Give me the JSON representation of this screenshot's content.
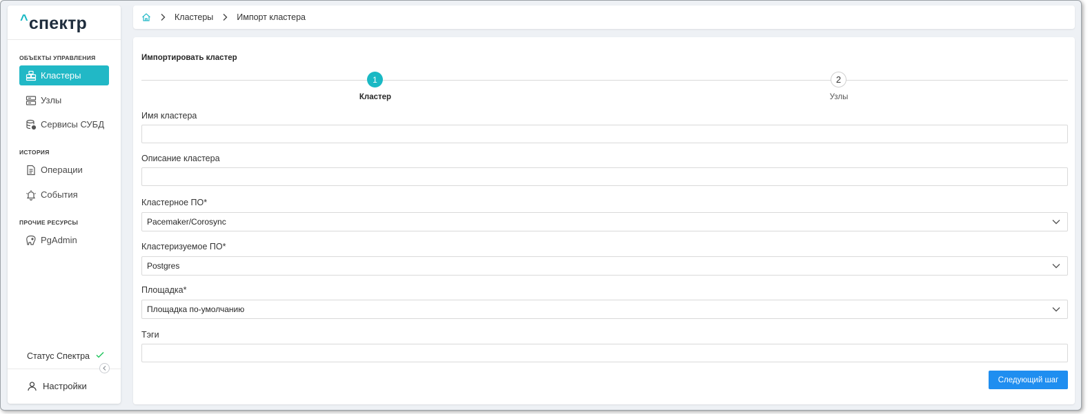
{
  "app": {
    "logo_caret": "^",
    "logo_text": "спектр"
  },
  "sidebar": {
    "sections": [
      {
        "title": "ОБЪЕКТЫ УПРАВЛЕНИЯ"
      },
      {
        "title": "ИСТОРИЯ"
      },
      {
        "title": "ПРОЧИЕ РЕСУРСЫ"
      }
    ],
    "items": [
      {
        "label": "Кластеры",
        "icon": "clusters-icon",
        "active": true
      },
      {
        "label": "Узлы",
        "icon": "nodes-icon",
        "active": false
      },
      {
        "label": "Сервисы СУБД",
        "icon": "database-services-icon",
        "active": false
      },
      {
        "label": "Операции",
        "icon": "operations-icon",
        "active": false
      },
      {
        "label": "События",
        "icon": "events-icon",
        "active": false
      },
      {
        "label": "PgAdmin",
        "icon": "pgadmin-icon",
        "active": false
      }
    ],
    "status_label": "Статус Спектра",
    "settings_label": "Настройки"
  },
  "breadcrumb": {
    "items": [
      "Кластеры",
      "Импорт кластера"
    ]
  },
  "form": {
    "title": "Импортировать кластер",
    "steps": [
      {
        "number": "1",
        "label": "Кластер",
        "active": true
      },
      {
        "number": "2",
        "label": "Узлы",
        "active": false
      }
    ],
    "fields": {
      "cluster_name": {
        "label": "Имя кластера",
        "value": ""
      },
      "cluster_description": {
        "label": "Описание кластера",
        "value": ""
      },
      "cluster_software": {
        "label": "Кластерное ПО*",
        "value": "Pacemaker/Corosync"
      },
      "clustered_software": {
        "label": "Кластеризуемое ПО*",
        "value": "Postgres"
      },
      "site": {
        "label": "Площадка*",
        "value": "Площадка по-умолчанию"
      },
      "tags": {
        "label": "Тэги",
        "value": ""
      }
    },
    "next_button": "Следующий шаг"
  },
  "colors": {
    "accent": "#21b8c6",
    "primary_button": "#1f8ef0",
    "status_ok": "#22c55e"
  }
}
